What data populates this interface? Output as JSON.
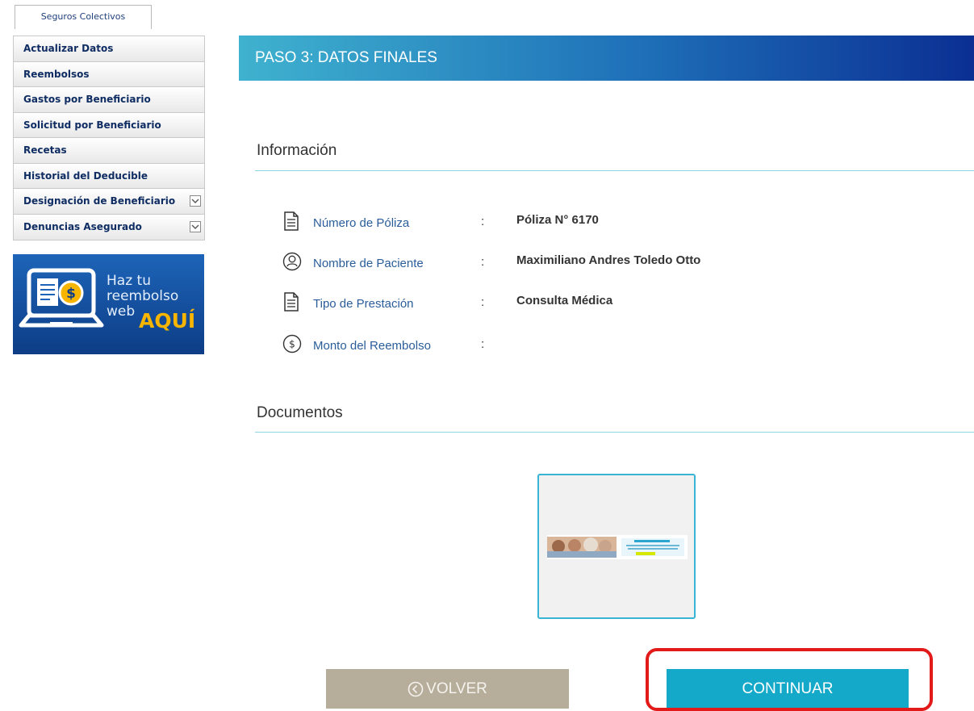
{
  "sidebar": {
    "tab_label": "Seguros Colectivos",
    "items": [
      {
        "label": "Actualizar Datos",
        "has_dropdown": false
      },
      {
        "label": "Reembolsos",
        "has_dropdown": false
      },
      {
        "label": "Gastos por Beneficiario",
        "has_dropdown": false
      },
      {
        "label": "Solicitud por Beneficiario",
        "has_dropdown": false
      },
      {
        "label": "Recetas",
        "has_dropdown": false
      },
      {
        "label": "Historial del Deducible",
        "has_dropdown": false
      },
      {
        "label": "Designación de Beneficiario",
        "has_dropdown": true
      },
      {
        "label": "Denuncias Asegurado",
        "has_dropdown": true
      }
    ],
    "banner": {
      "line1": "Haz tu",
      "line2": "reembolso",
      "line3": "web",
      "highlight": "AQUÍ",
      "icon": "laptop-refund-icon"
    }
  },
  "main": {
    "step_title": "PASO 3: DATOS FINALES",
    "info_section_title": "Información",
    "info_rows": [
      {
        "icon": "document-icon",
        "label": "Número de Póliza",
        "separator": ":",
        "value": "Póliza N° 6170"
      },
      {
        "icon": "user-icon",
        "label": "Nombre de Paciente",
        "separator": ":",
        "value": "Maximiliano Andres Toledo Otto"
      },
      {
        "icon": "document-icon",
        "label": "Tipo de Prestación",
        "separator": ":",
        "value": "Consulta Médica"
      },
      {
        "icon": "dollar-circle-icon",
        "label": "Monto del Reembolso",
        "separator": ":",
        "value": ""
      }
    ],
    "documents_section_title": "Documentos",
    "buttons": {
      "back_label": "VOLVER",
      "back_icon": "chevron-left-circle-icon",
      "continue_label": "CONTINUAR"
    }
  },
  "colors": {
    "header_gradient_start": "#3fb2cf",
    "header_gradient_end": "#0b2f93",
    "back_button": "#b7ad9b",
    "continue_button": "#15a9c9",
    "highlight_outline": "#e21a1a",
    "menu_text": "#0f2d63"
  }
}
